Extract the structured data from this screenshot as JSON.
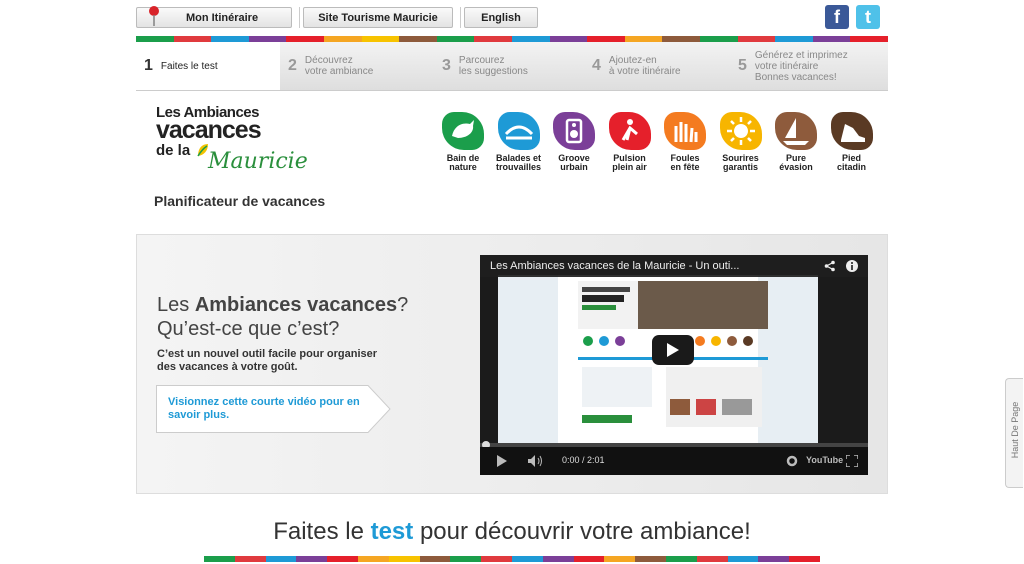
{
  "topnav": {
    "itinerary_label": "Mon Itinéraire",
    "tourism_label": "Site Tourisme Mauricie",
    "language_label": "English"
  },
  "social": {
    "facebook_glyph": "f",
    "twitter_glyph": "t"
  },
  "color_band": [
    "#1b9e4b",
    "#e03a3e",
    "#1e9ad6",
    "#7b3f98",
    "#e5202b",
    "#f5a623",
    "#f7c300",
    "#8e5b3c",
    "#1b9e4b",
    "#e03a3e",
    "#1e9ad6",
    "#7b3f98",
    "#e5202b",
    "#f5a623",
    "#8e5b3c",
    "#1b9e4b",
    "#e03a3e",
    "#1e9ad6",
    "#7b3f98",
    "#e5202b"
  ],
  "steps": [
    {
      "num": "1",
      "label": "Faites le test",
      "active": true
    },
    {
      "num": "2",
      "label": "Découvrez\nvotre ambiance",
      "active": false
    },
    {
      "num": "3",
      "label": "Parcourez\nles suggestions",
      "active": false
    },
    {
      "num": "4",
      "label": "Ajoutez-en\nà votre itinéraire",
      "active": false
    },
    {
      "num": "5",
      "label": "Générez et imprimez\nvotre itinéraire\nBonnes vacances!",
      "active": false
    }
  ],
  "logo": {
    "line1": "Les Ambiances",
    "line2": "vacances",
    "line3": "de la",
    "line4": "Mauricie"
  },
  "ambiances": [
    {
      "label": "Bain de\nnature",
      "color": "#1b9e4b",
      "icon": "bird-icon"
    },
    {
      "label": "Balades et\ntrouvailles",
      "color": "#1e9ad6",
      "icon": "bridge-icon"
    },
    {
      "label": "Groove\nurbain",
      "color": "#7b3f98",
      "icon": "speaker-icon"
    },
    {
      "label": "Pulsion\nplein air",
      "color": "#e5202b",
      "icon": "bike-icon"
    },
    {
      "label": "Foules\nen fête",
      "color": "#f47b20",
      "icon": "hands-icon"
    },
    {
      "label": "Sourires\ngarantis",
      "color": "#f7b500",
      "icon": "sun-icon"
    },
    {
      "label": "Pure\névasion",
      "color": "#8e5b3c",
      "icon": "sailboat-icon"
    },
    {
      "label": "Pied\ncitadin",
      "color": "#5a3a24",
      "icon": "shoe-icon"
    }
  ],
  "planner_title": "Planificateur de vacances",
  "hero": {
    "title_pre": "Les ",
    "title_bold": "Ambiances vacances",
    "title_post": "?",
    "title_line2": "Qu’est-ce que c’est?",
    "description": "C’est un nouvel outil facile pour organiser des vacances à votre goût.",
    "cta": "Visionnez cette courte vidéo pour en savoir plus."
  },
  "video": {
    "title": "Les Ambiances vacances de la Mauricie - Un outi...",
    "time": "0:00 / 2:01",
    "brand": "YouTube"
  },
  "tagline": {
    "pre": "Faites le ",
    "bold": "test",
    "post": " pour découvrir votre ambiance!"
  },
  "side_tab": "Haut De Page"
}
